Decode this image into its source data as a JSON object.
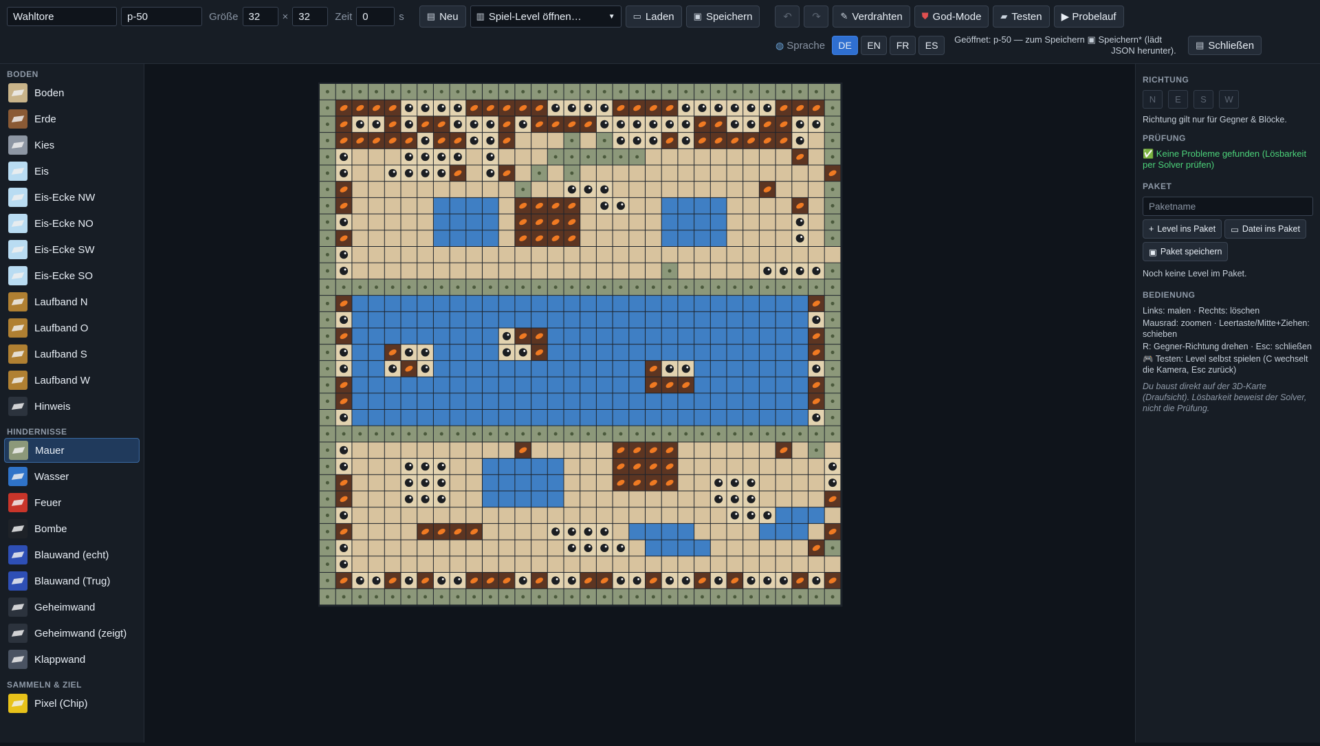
{
  "toolbar": {
    "name_value": "Wahltore",
    "id_value": "p-50",
    "size_label": "Größe",
    "width_value": "32",
    "times": "×",
    "height_value": "32",
    "time_label": "Zeit",
    "time_value": "0",
    "time_unit": "s",
    "new_label": "Neu",
    "open_select": "Spiel-Level öffnen…",
    "load_label": "Laden",
    "save_label": "Speichern",
    "undo_icon": "undo-icon",
    "redo_icon": "redo-icon",
    "wire_label": "Verdrahten",
    "god_label": "God-Mode",
    "test_label": "Testen",
    "trial_label": "▶ Probelauf",
    "language_label": "Sprache",
    "languages": [
      "DE",
      "EN",
      "FR",
      "ES"
    ],
    "active_language": "DE",
    "status_line1": "Geöffnet: p-50 — zum Speichern",
    "status_save_hint": "Speichern* (lädt",
    "status_line2": "JSON herunter).",
    "close_label": "Schließen"
  },
  "sidebar": {
    "sections": [
      {
        "title": "BODEN",
        "items": [
          {
            "label": "Boden",
            "color": "#c9b48a"
          },
          {
            "label": "Erde",
            "color": "#8a5a35"
          },
          {
            "label": "Kies",
            "color": "#8d96a3"
          },
          {
            "label": "Eis",
            "color": "#b9dcf2"
          },
          {
            "label": "Eis-Ecke NW",
            "color": "#b9dcf2"
          },
          {
            "label": "Eis-Ecke NO",
            "color": "#b9dcf2"
          },
          {
            "label": "Eis-Ecke SW",
            "color": "#b9dcf2"
          },
          {
            "label": "Eis-Ecke SO",
            "color": "#b9dcf2"
          },
          {
            "label": "Laufband N",
            "color": "#b08032"
          },
          {
            "label": "Laufband O",
            "color": "#b08032"
          },
          {
            "label": "Laufband S",
            "color": "#b08032"
          },
          {
            "label": "Laufband W",
            "color": "#b08032"
          },
          {
            "label": "Hinweis",
            "color": "#2c333d"
          }
        ]
      },
      {
        "title": "HINDERNISSE",
        "items": [
          {
            "label": "Mauer",
            "color": "#8c987a",
            "active": true
          },
          {
            "label": "Wasser",
            "color": "#2f73c8"
          },
          {
            "label": "Feuer",
            "color": "#c8352a"
          },
          {
            "label": "Bombe",
            "color": "#1e2228"
          },
          {
            "label": "Blauwand (echt)",
            "color": "#2e4fb5"
          },
          {
            "label": "Blauwand (Trug)",
            "color": "#2e4fb5"
          },
          {
            "label": "Geheimwand",
            "color": "#2c333d"
          },
          {
            "label": "Geheimwand (zeigt)",
            "color": "#2c333d"
          },
          {
            "label": "Klappwand",
            "color": "#4a5362"
          }
        ]
      },
      {
        "title": "SAMMELN & ZIEL",
        "items": [
          {
            "label": "Pixel (Chip)",
            "color": "#e8c21a"
          }
        ]
      }
    ]
  },
  "right": {
    "direction_title": "RICHTUNG",
    "directions": [
      "N",
      "E",
      "S",
      "W"
    ],
    "direction_hint": "Richtung gilt nur für Gegner & Blöcke.",
    "check_title": "PRÜFUNG",
    "check_result": "✅ Keine Probleme gefunden (Lösbarkeit per Solver prüfen)",
    "package_title": "PAKET",
    "package_placeholder": "Paketname",
    "level_to_package": "Level ins Paket",
    "file_to_package": "Datei ins Paket",
    "save_package": "Paket speichern",
    "package_empty": "Noch keine Level im Paket.",
    "controls_title": "BEDIENUNG",
    "controls": [
      "Links: malen · Rechts: löschen",
      "Mausrad: zoomen · Leertaste/Mitte+Ziehen: schieben",
      "R: Gegner-Richtung drehen · Esc: schließen",
      "🎮 Testen: Level selbst spielen (C wechselt die Kamera, Esc zurück)"
    ],
    "note": "Du baust direkt auf der 3D-Karte (Draufsicht). Lösbarkeit beweist der Solver, nicht die Prüfung."
  },
  "map": {
    "size": 32,
    "colors": {
      "wall": "#8c987a",
      "floor": "#d8c39e",
      "water": "#3f7fc4",
      "fire": "#5c3522",
      "bomb": "#e3d3b0"
    },
    "rows": [
      "################################",
      "#FFFFBBBBFFFFFBBBBFFFFBBBBBBFFF#",
      "#FBBFBFFBBBFBFFFFBBBBBBFFBBFFBB#",
      "#FFFFFBFFBBF...#.#BBBFBFFFFFFB.#",
      "#B...BBBB.B...######.........F.#",
      "#B..BBBBF.BF.#.#...............F#",
      "#F..........#..BBB.........F...#",
      "#F.....WWWW.FFFF.BB..WWWW....F.#",
      "#B.....WWWW.FFFF.....WWWW....B.#",
      "#F.....WWWW.FFFF.....WWWW....B.#",
      "#B..............................#",
      "#B...................#.....BBBB#",
      "################################",
      "#FWWWWWWWWWWWWWWWWWWWWWWWWWWWWF#",
      "#BWWWWWWWWWWWWWWWWWWWWWWWWWWWWB#",
      "#FWWWWWWWWWBFFWWWWWWWWWWWWWWWWF#",
      "#BWWFBBWWWWBBFWWWWWWWWWWWWWWWWF#",
      "#BWWBFBWWWWWWWWWWWWWFBBWWWWWWWB#",
      "#FWWWWWWWWWWWWWWWWWWFFFWWWWWWWF#",
      "#FWWWWWWWWWWWWWWWWWWWWWWWWWWWWF#",
      "#BWWWWWWWWWWWWWWWWWWWWWWWWWWWWB#",
      "################################",
      "#B..........F.....FFFF......F.#",
      "#B...BBB..WWWWW...FFFF.........B#",
      "#F...BBB..WWWWW...FFFF..BBB....B#",
      "#F...BBB..WWWWW.........BBB....F#",
      "#B.......................BBBWWW.B#",
      "#F....FFFF....BBBB.WWWW....WWW.F#",
      "#B.............BBBB.WWWW......F#",
      "#B..............................#",
      "#FBBFBFBBFFFBFBBFFBBFBBFBFBBBFBF#",
      "################################"
    ]
  }
}
